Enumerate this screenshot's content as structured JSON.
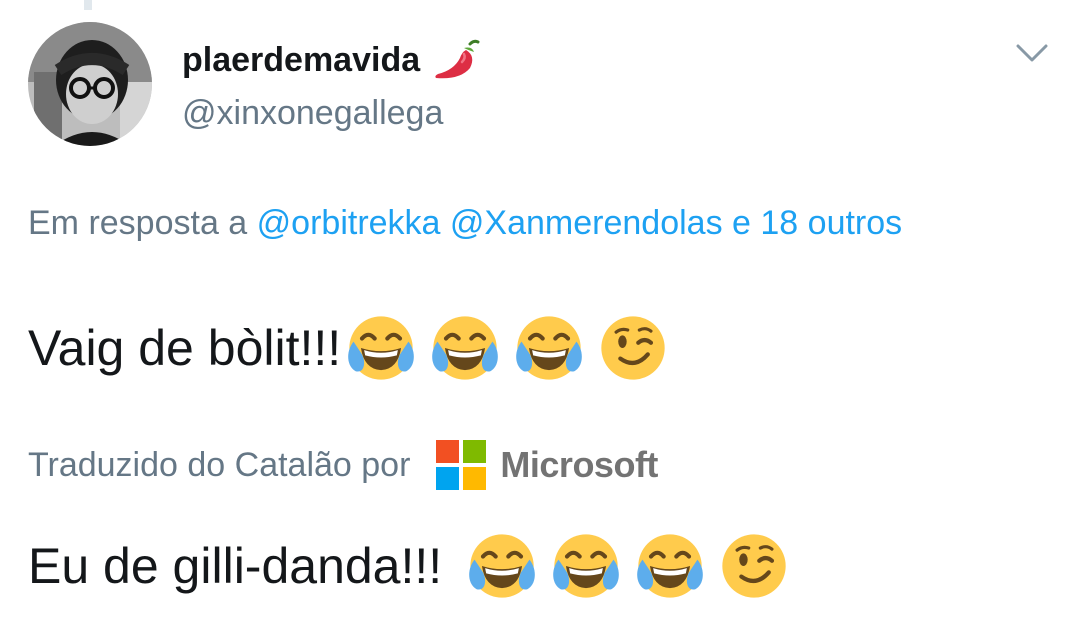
{
  "tweet": {
    "author": {
      "display_name": "plaerdemavida",
      "handle": "@xinxonegallega",
      "name_emoji": "chili-pepper-icon"
    },
    "reply_context": {
      "prefix": "Em resposta a",
      "mentions": [
        "@orbitrekka",
        "@Xanmerendolas"
      ],
      "suffix": "e 18 outros"
    },
    "text": "Vaig de bòlit!!!",
    "emojis": [
      "laughing-tears-icon",
      "laughing-tears-icon",
      "laughing-tears-icon",
      "winking-face-icon"
    ]
  },
  "translation": {
    "label": "Traduzido do Catalão por",
    "provider": "Microsoft",
    "text": "Eu de gilli-danda!!!",
    "emojis": [
      "laughing-tears-icon",
      "laughing-tears-icon",
      "laughing-tears-icon",
      "winking-face-icon"
    ]
  },
  "colors": {
    "link": "#1da1f2",
    "secondary_text": "#657786",
    "primary_text": "#14171a",
    "emoji_yellow": "#FFCB4C",
    "microsoft_red": "#F25022",
    "microsoft_green": "#7FBA00",
    "microsoft_blue": "#00A4EF",
    "microsoft_yellow": "#FFB900"
  }
}
